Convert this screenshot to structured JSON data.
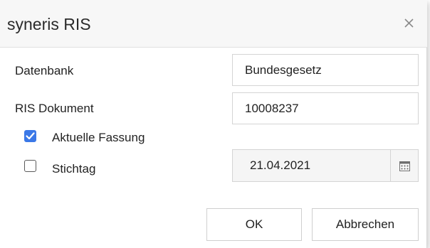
{
  "dialog": {
    "title": "syneris RIS",
    "close_icon": "close-icon"
  },
  "form": {
    "datenbank_label": "Datenbank",
    "datenbank_value": "Bundesgesetz",
    "dokument_label": "RIS Dokument",
    "dokument_value": "10008237",
    "aktuelle_label": "Aktuelle Fassung",
    "aktuelle_checked": true,
    "stichtag_label": "Stichtag",
    "stichtag_checked": false,
    "stichtag_value": "21.04.2021",
    "calendar_icon": "calendar-icon"
  },
  "buttons": {
    "ok_label": "OK",
    "cancel_label": "Abbrechen"
  },
  "colors": {
    "accent": "#3b78e7",
    "titlebar": "#f7f7f7",
    "disabled_field": "#f5f5f5"
  }
}
